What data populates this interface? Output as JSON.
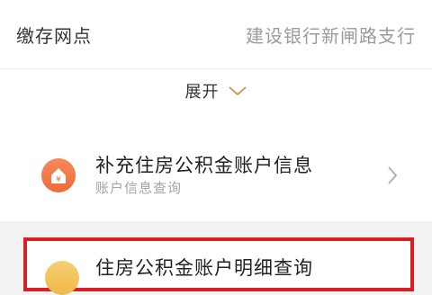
{
  "branch": {
    "label": "缴存网点",
    "value": "建设银行新闸路支行"
  },
  "expand": {
    "label": "展开"
  },
  "items": [
    {
      "title": "补充住房公积金账户信息",
      "subtitle": "账户信息查询",
      "badge_color": "#f07a4a",
      "icon": "yuan-house-icon"
    },
    {
      "title": "住房公积金账户明细查询",
      "badge_color": "#f3c15a",
      "highlight_color": "#d81f26"
    }
  ]
}
